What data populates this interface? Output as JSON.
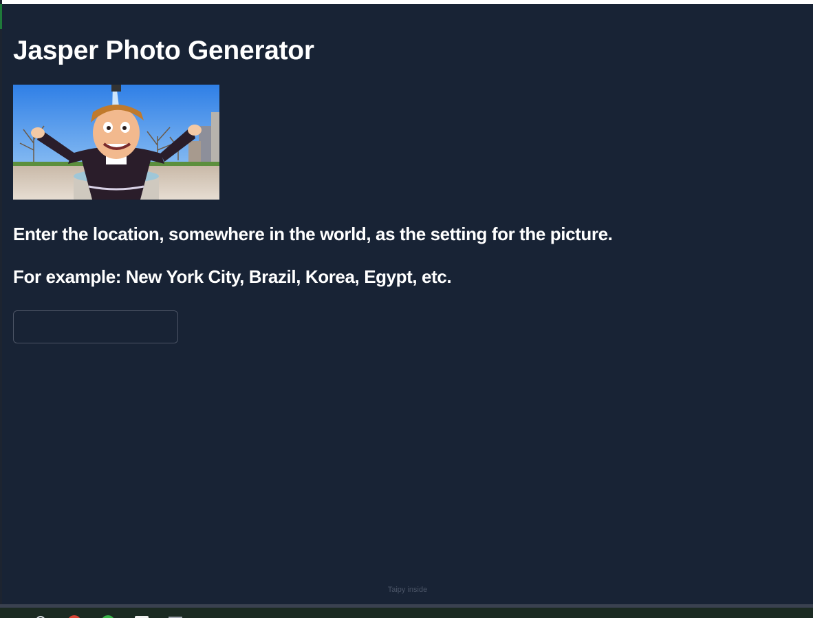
{
  "app": {
    "title": "Jasper Photo Generator",
    "instruction_primary": "Enter the location, somewhere in the world, as the setting for the picture.",
    "instruction_example": "For example: New York City, Brazil, Korea, Egypt, etc.",
    "location_input": {
      "value": "",
      "placeholder": ""
    },
    "footer": "Taipy inside"
  },
  "taskbar": {
    "icons": [
      "search-icon",
      "chrome-icon",
      "green-app-icon",
      "notepad-icon",
      "file-icon",
      "office-icon",
      "yellow-app-icon"
    ]
  },
  "colors": {
    "background": "#182335",
    "text": "#ffffff",
    "input_border": "#4d5566",
    "footer_text": "#4a5466"
  }
}
